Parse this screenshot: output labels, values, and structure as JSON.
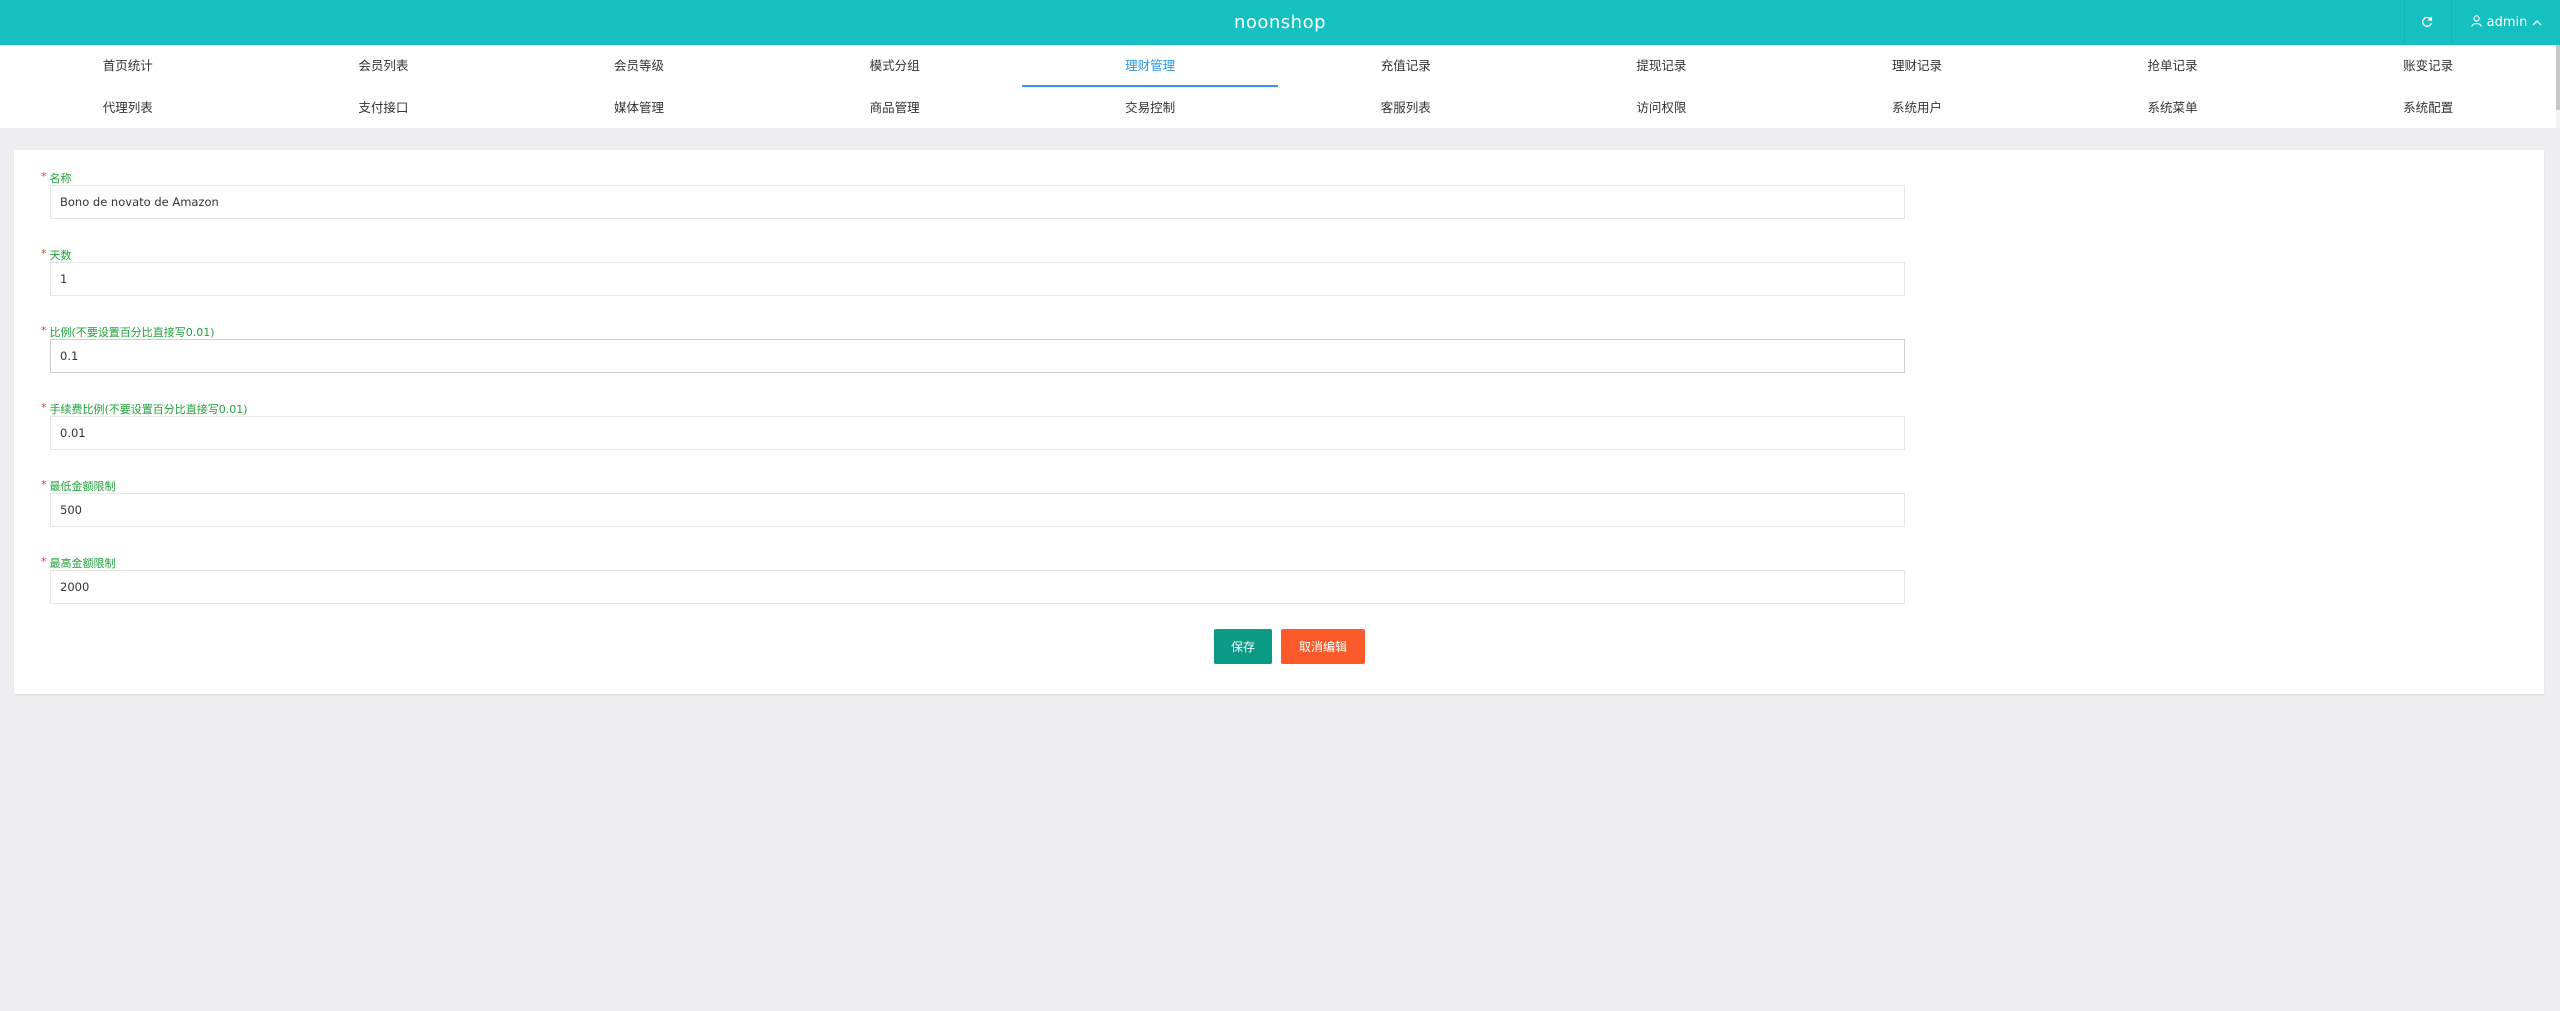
{
  "header": {
    "brand": "noonshop",
    "user": "admin",
    "refresh_icon": "refresh-icon",
    "user_icon": "user-icon",
    "caret_icon": "chevron-up-icon",
    "background_color": "#15c0c0"
  },
  "nav": {
    "row1": [
      "首页统计",
      "会员列表",
      "会员等级",
      "模式分组",
      "理财管理",
      "充值记录",
      "提现记录",
      "理财记录",
      "抢单记录",
      "账变记录"
    ],
    "row2": [
      "代理列表",
      "支付接口",
      "媒体管理",
      "商品管理",
      "交易控制",
      "客服列表",
      "访问权限",
      "系统用户",
      "系统菜单",
      "系统配置"
    ],
    "active": "理财管理",
    "active_color": "#2f96e8"
  },
  "form": {
    "required_mark": "*",
    "fields": [
      {
        "label": "名称",
        "value": "Bono de novato de Amazon"
      },
      {
        "label": "天数",
        "value": "1"
      },
      {
        "label": "比例(不要设置百分比直接写0.01)",
        "value": "0.1"
      },
      {
        "label": "手续费比例(不要设置百分比直接写0.01)",
        "value": "0.01"
      },
      {
        "label": "最低金额限制",
        "value": "500"
      },
      {
        "label": "最高金额限制",
        "value": "2000"
      }
    ],
    "save_label": "保存",
    "cancel_label": "取消编辑",
    "label_color": "#1fa13a",
    "required_color": "#e53b2d",
    "save_color": "#0b9a86",
    "cancel_color": "#fd5a2b"
  }
}
